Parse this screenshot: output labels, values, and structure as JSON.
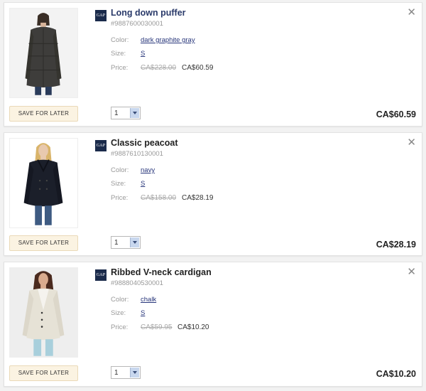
{
  "brand_logo_text": "GAP",
  "save_for_later_label": "SAVE FOR LATER",
  "close_symbol": "✕",
  "labels": {
    "color": "Color:",
    "size": "Size:",
    "price": "Price:"
  },
  "items": [
    {
      "name": "Long down puffer",
      "sku": "#9887600030001",
      "color": "dark graphite gray",
      "size": "S",
      "original_price": "CA$228.00",
      "sale_price": "CA$60.59",
      "quantity": "1",
      "total": "CA$60.59",
      "garment_color": "#3e3d3b"
    },
    {
      "name": "Classic peacoat",
      "sku": "#9887610130001",
      "color": "navy",
      "size": "S",
      "original_price": "CA$158.00",
      "sale_price": "CA$28.19",
      "quantity": "1",
      "total": "CA$28.19",
      "garment_color": "#1b1f2a"
    },
    {
      "name": "Ribbed V-neck cardigan",
      "sku": "#9888040530001",
      "color": "chalk",
      "size": "S",
      "original_price": "CA$59.95",
      "sale_price": "CA$10.20",
      "quantity": "1",
      "total": "CA$10.20",
      "garment_color": "#e6e2d6"
    }
  ]
}
